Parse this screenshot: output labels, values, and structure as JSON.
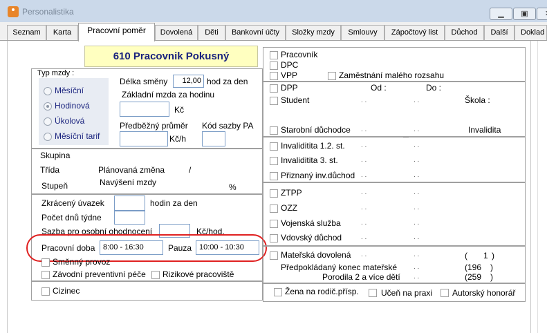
{
  "window": {
    "title": "Personalistika"
  },
  "tabs": [
    {
      "label": "Seznam"
    },
    {
      "label": "Karta"
    },
    {
      "label": "Pracovní poměr"
    },
    {
      "label": "Dovolená"
    },
    {
      "label": "Děti"
    },
    {
      "label": "Bankovní účty"
    },
    {
      "label": "Složky mzdy"
    },
    {
      "label": "Smlouvy"
    },
    {
      "label": "Zápočtový list"
    },
    {
      "label": "Důchod"
    },
    {
      "label": "Další"
    },
    {
      "label": "Doklad"
    }
  ],
  "employee": {
    "name": "610 Pracovnik Pokusný"
  },
  "wage": {
    "type_label": "Typ mzdy :",
    "options": [
      "Měsíční",
      "Hodinová",
      "Úkolová",
      "Měsíční tarif"
    ],
    "selected": "Hodinová",
    "shift_length_label": "Délka směny",
    "shift_length_value": "12,00",
    "shift_length_unit": "hod za den",
    "base_wage_label": "Základní mzda za hodinu",
    "base_wage_value": "",
    "base_wage_unit": "Kč",
    "avg_label": "Předběžný průměr",
    "avg_value": "",
    "avg_unit": "Kč/h",
    "rate_code_label": "Kód sazby PA",
    "rate_code_value": ""
  },
  "group": {
    "skupina_label": "Skupina",
    "trida_label": "Třída",
    "planned_change_label": "Plánovaná změna",
    "slash": "/",
    "stupen_label": "Stupeň",
    "raise_label": "Navýšení mzdy",
    "percent": "%"
  },
  "hours": {
    "reduced_label": "Zkrácený úvazek",
    "reduced_value": "",
    "reduced_unit": "hodin za den",
    "days_label": "Počet dnů  týdne",
    "days_value": "",
    "personal_rate_label": "Sazba pro osobní ohodnocení",
    "personal_rate_value": "",
    "personal_rate_unit": "Kč/hod.",
    "working_time_label": "Pracovní doba",
    "working_time_value": "8:00 - 16:30",
    "pause_label": "Pauza",
    "pause_value": "10:00 - 10:30",
    "shift_mode_label": "Směnný provoz",
    "preventive_care_label": "Závodní preventivní péče",
    "risky_workplace_label": "Rizikové pracoviště",
    "foreigner_label": "Cizinec"
  },
  "right": {
    "pracovnik": "Pracovník",
    "dpc": "DPC",
    "vpp": "VPP",
    "small_scope": "Zaměstnání malého rozsahu",
    "dpp": "DPP",
    "od_label": "Od :",
    "do_label": "Do :",
    "student": "Student",
    "skola_label": "Škola :",
    "starobni": "Starobní důchodce",
    "invalidita_label": "Invalidita",
    "inv12": "Invaliditita 1.2. st.",
    "inv3": "Invaliditita 3. st.",
    "priznany": "Přiznaný inv.důchod",
    "ztpp": "ZTPP",
    "ozz": "OZZ",
    "vojenska": "Vojenská služba",
    "vdovsky": "Vdovský důchod",
    "maternity": "Mateřská dovolená",
    "maternity_open": "(",
    "maternity_value": "1",
    "maternity_close": ")",
    "maternity_end_label": "Předpokládaný konec mateřské",
    "maternity_end_open": "(196",
    "maternity_end_close": ")",
    "twins_label": "Porodila 2 a více dětí",
    "twins_open": "(259",
    "twins_close": ")",
    "zena": "Žena na rodič.přísp.",
    "ucen": "Učeň na praxi",
    "autorsky": "Autorský honorář",
    "dots": ". ."
  }
}
